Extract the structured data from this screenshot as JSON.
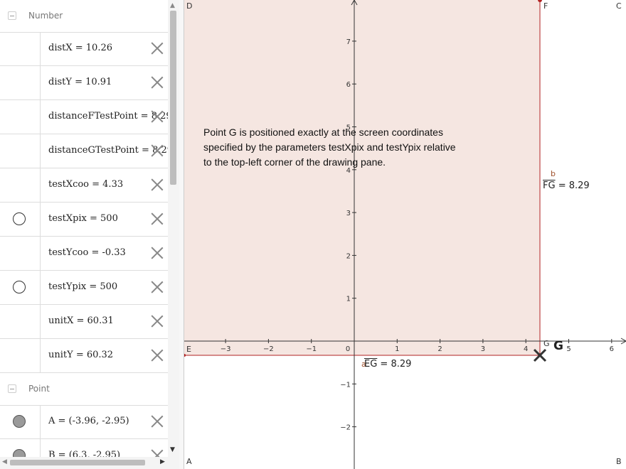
{
  "algebra": {
    "groups": [
      {
        "title": "Number",
        "items": [
          {
            "text": "distX = 10.26",
            "marble": "none"
          },
          {
            "text": "distY = 10.91",
            "marble": "none"
          },
          {
            "text": "distanceFTestPoint = 8.29",
            "marble": "none"
          },
          {
            "text": "distanceGTestPoint = 8.29",
            "marble": "none"
          },
          {
            "text": "testXcoo = 4.33",
            "marble": "none"
          },
          {
            "text": "testXpix = 500",
            "marble": "empty"
          },
          {
            "text": "testYcoo = -0.33",
            "marble": "none"
          },
          {
            "text": "testYpix = 500",
            "marble": "empty"
          },
          {
            "text": "unitX = 60.31",
            "marble": "none"
          },
          {
            "text": "unitY = 60.32",
            "marble": "none"
          }
        ]
      },
      {
        "title": "Point",
        "items": [
          {
            "text": "A = (-3.96, -2.95)",
            "marble": "filled"
          },
          {
            "text": "B = (6.3, -2.95)",
            "marble": "filled"
          }
        ]
      }
    ]
  },
  "graphics": {
    "info_text": "Point G is positioned exactly at the screen coordinates specified by the parameters testXpix and testYpix relative to the top-left corner of the drawing pane.",
    "corner_labels": {
      "D": "D",
      "C": "C",
      "A": "A",
      "B": "B",
      "E": "E",
      "F": "F",
      "G_small": "G"
    },
    "point_g_label": "G",
    "segment_fg": {
      "name": "FG",
      "value": "8.29",
      "letter": "b"
    },
    "segment_eg": {
      "name": "EG",
      "value": "8.29",
      "letter": "a"
    },
    "x_ticks": [
      "−3",
      "−2",
      "−1",
      "0",
      "1",
      "2",
      "3",
      "4",
      "5",
      "6"
    ],
    "y_ticks": [
      "7",
      "6",
      "5",
      "4",
      "3",
      "2",
      "1",
      "−1",
      "−2"
    ],
    "colors": {
      "rect_fill": "#f5e6e1",
      "rect_stroke": "#b22222",
      "axis": "#333333"
    }
  }
}
